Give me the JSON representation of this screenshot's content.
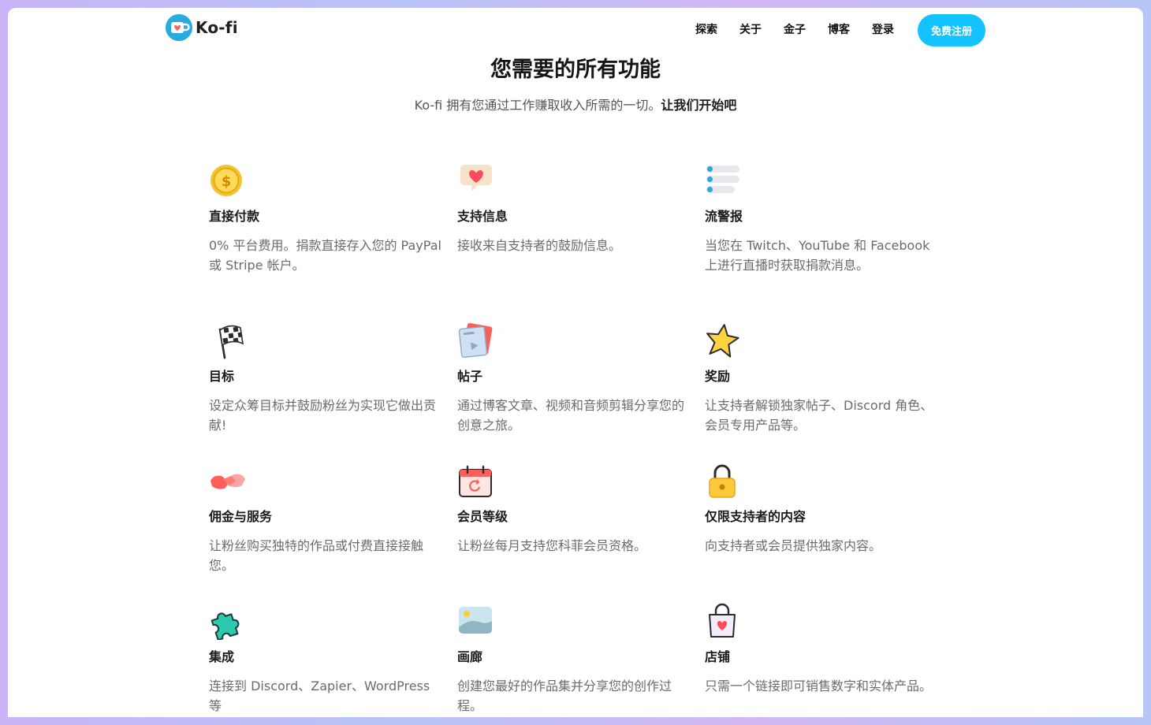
{
  "header": {
    "logo_text": "Ko-fi",
    "nav": [
      "探索",
      "关于",
      "金子",
      "博客",
      "登录"
    ],
    "signup_label": "免费注册"
  },
  "hero": {
    "title": "您需要的所有功能",
    "subtitle": "Ko-fi 拥有您通过工作赚取收入所需的一切。",
    "cta": "让我们开始吧"
  },
  "features": [
    {
      "icon": "coin-icon",
      "title": "直接付款",
      "desc": "0% 平台费用。捐款直接存入您的 PayPal 或 Stripe 帐户。"
    },
    {
      "icon": "heart-message-icon",
      "title": "支持信息",
      "desc": "接收来自支持者的鼓励信息。"
    },
    {
      "icon": "stream-alert-icon",
      "title": "流警报",
      "desc": "当您在 Twitch、YouTube 和 Facebook 上进行直播时获取捐款消息。"
    },
    {
      "icon": "checkered-flag-icon",
      "title": "目标",
      "desc": "设定众筹目标并鼓励粉丝为实现它做出贡献!"
    },
    {
      "icon": "posts-icon",
      "title": "帖子",
      "desc": "通过博客文章、视频和音频剪辑分享您的创意之旅。"
    },
    {
      "icon": "star-icon",
      "title": "奖励",
      "desc": "让支持者解锁独家帖子、Discord 角色、会员专用产品等。"
    },
    {
      "icon": "handshake-icon",
      "title": "佣金与服务",
      "desc": "让粉丝购买独特的作品或付费直接接触您。"
    },
    {
      "icon": "calendar-icon",
      "title": "会员等级",
      "desc": "让粉丝每月支持您科菲会员资格。"
    },
    {
      "icon": "padlock-icon",
      "title": "仅限支持者的内容",
      "desc": "向支持者或会员提供独家内容。"
    },
    {
      "icon": "puzzle-icon",
      "title": "集成",
      "desc": "连接到 Discord、Zapier、WordPress 等"
    },
    {
      "icon": "gallery-icon",
      "title": "画廊",
      "desc": "创建您最好的作品集并分享您的创作过程。"
    },
    {
      "icon": "shopping-bag-icon",
      "title": "店铺",
      "desc": "只需一个链接即可销售数字和实体产品。"
    }
  ]
}
